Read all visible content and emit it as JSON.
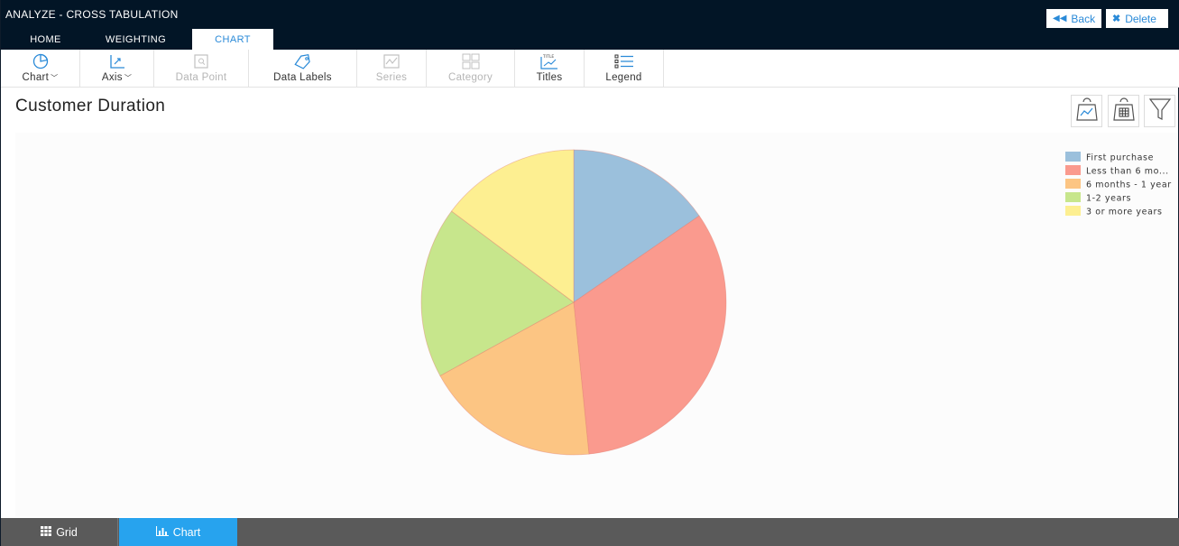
{
  "app": {
    "title": "ANALYZE - CROSS TABULATION",
    "back_label": "Back",
    "delete_label": "Delete",
    "accent": "#2a8ad8",
    "header_bg": "#021526"
  },
  "tabs": [
    {
      "label": "HOME"
    },
    {
      "label": "WEIGHTING"
    },
    {
      "label": "CHART",
      "active": true
    }
  ],
  "ribbon": [
    {
      "label": "Chart",
      "icon": "pie-chart-icon",
      "dropdown": true,
      "enabled": true
    },
    {
      "label": "Axis",
      "icon": "axis-icon",
      "dropdown": true,
      "enabled": true
    },
    {
      "label": "Data Point",
      "icon": "data-point-icon",
      "enabled": false
    },
    {
      "label": "Data Labels",
      "icon": "tag-icon",
      "enabled": true
    },
    {
      "label": "Series",
      "icon": "series-icon",
      "enabled": false
    },
    {
      "label": "Category",
      "icon": "category-grid-icon",
      "enabled": false
    },
    {
      "label": "Titles",
      "icon": "titles-icon",
      "enabled": true
    },
    {
      "label": "Legend",
      "icon": "legend-list-icon",
      "enabled": true
    }
  ],
  "page": {
    "title": "Customer Duration"
  },
  "toolbar_icons": [
    "export-chart-icon",
    "export-table-icon",
    "filter-icon"
  ],
  "chart_data": {
    "type": "pie",
    "title": "",
    "categories": [
      "First purchase",
      "Less than 6 mo...",
      "6 months - 1 year",
      "1-2 years",
      "3 or more years"
    ],
    "values": [
      15.4,
      33.0,
      18.6,
      18.2,
      14.8
    ],
    "colors": [
      "#9bc0dc",
      "#fa9a8e",
      "#fcc583",
      "#c7e68c",
      "#fdef91"
    ],
    "legend_position": "top-right"
  },
  "bottom_tabs": [
    {
      "label": "Grid",
      "icon": "grid-icon"
    },
    {
      "label": "Chart",
      "icon": "bar-chart-icon",
      "active": true
    }
  ]
}
